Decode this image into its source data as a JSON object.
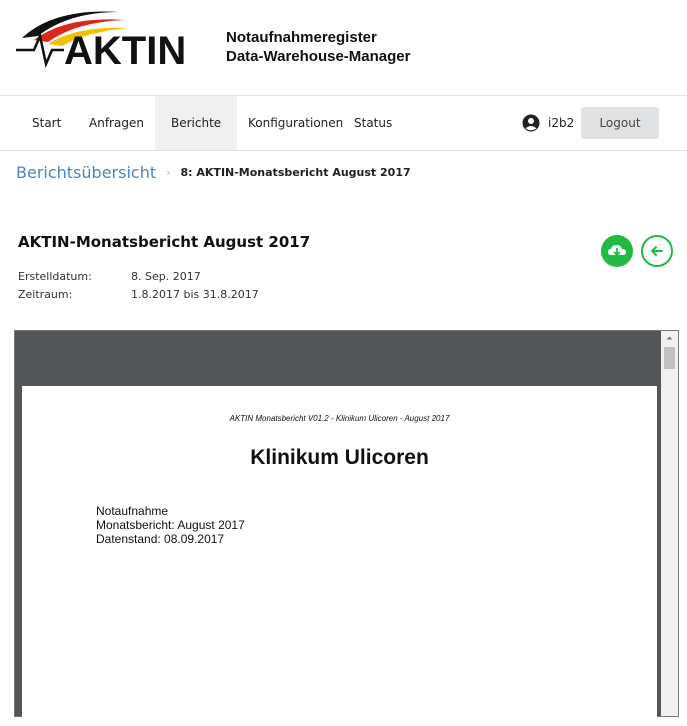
{
  "header": {
    "logo_text": "AKTIN",
    "app_title_line1": "Notaufnahmeregister",
    "app_title_line2": "Data-Warehouse-Manager"
  },
  "nav": {
    "items": [
      {
        "label": "Start"
      },
      {
        "label": "Anfragen"
      },
      {
        "label": "Berichte",
        "active": true
      },
      {
        "label": "Konfigurationen"
      },
      {
        "label": "Status"
      }
    ],
    "user": "i2b2",
    "logout_label": "Logout"
  },
  "breadcrumb": {
    "parent": "Berichtsübersicht",
    "separator": "›",
    "current": "8: AKTIN-Monatsbericht August 2017"
  },
  "report": {
    "title": "AKTIN-Monatsbericht August 2017",
    "created_label": "Erstelldatum:",
    "created_value": "8. Sep. 2017",
    "period_label": "Zeitraum:",
    "period_value": "1.8.2017 bis 31.8.2017"
  },
  "pdf": {
    "header": "AKTIN Monatsbericht V01.2 - Klinikum Ulicoren - August 2017",
    "title": "Klinikum Ulicoren",
    "lines": [
      "Notaufnahme",
      "Monatsbericht: August 2017",
      "Datenstand: 08.09.2017"
    ]
  },
  "colors": {
    "accent_green": "#21ba45",
    "link_blue": "#4a86c0",
    "viewer_bg": "#525659",
    "logo_red": "#d9271c",
    "logo_yellow": "#f2c200"
  },
  "icons": {
    "download": "cloud-download-icon",
    "back": "arrow-left-icon",
    "user": "user-circle-icon"
  }
}
